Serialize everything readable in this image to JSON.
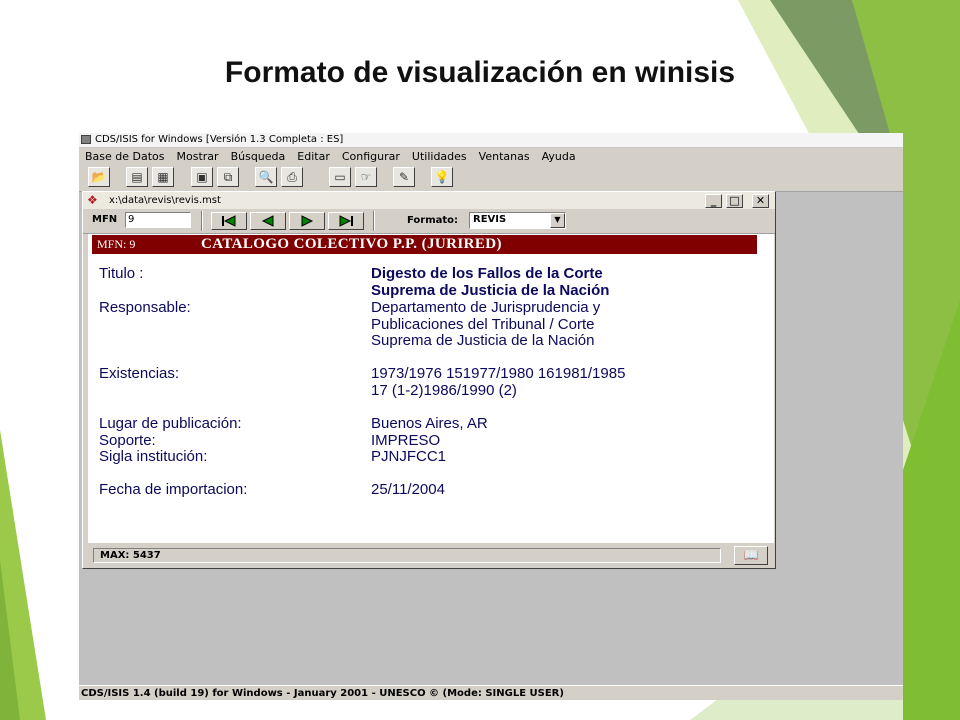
{
  "slide": {
    "title": "Formato de visualización en winisis"
  },
  "app": {
    "title": "CDS/ISIS for Windows [Versión 1.3 Completa : ES]",
    "menu": [
      "Base de Datos",
      "Mostrar",
      "Búsqueda",
      "Editar",
      "Configurar",
      "Utilidades",
      "Ventanas",
      "Ayuda"
    ],
    "status": "CDS/ISIS 1.4 (build 19) for Windows - January 2001 - UNESCO © (Mode: SINGLE USER)"
  },
  "child_window": {
    "title": "x:\\data\\revis\\revis.mst",
    "mfn_label": "MFN",
    "mfn_value": "9",
    "format_label": "Formato:",
    "format_value": "REVIS",
    "status_text": "MAX: 5437"
  },
  "record": {
    "header_mfn": "MFN: 9",
    "header_title": "CATALOGO COLECTIVO P.P. (JURIRED)",
    "fields": [
      {
        "label": "Titulo :",
        "lines": [
          "Digesto de los Fallos de la Corte",
          "Suprema de Justicia de la Nación"
        ],
        "bold": true
      },
      {
        "label": "Responsable:",
        "lines": [
          "Departamento de Jurisprudencia y",
          "Publicaciones del Tribunal / Corte",
          "Suprema de Justicia de la Nación"
        ]
      },
      {
        "label": "Existencias:",
        "lines": [
          "1973/1976 151977/1980 161981/1985",
          "17 (1-2)1986/1990 (2)"
        ]
      },
      {
        "label": "Lugar de publicación:",
        "lines": [
          "Buenos Aires, AR"
        ]
      },
      {
        "label": "Soporte:",
        "lines": [
          "IMPRESO"
        ]
      },
      {
        "label": "Sigla institución:",
        "lines": [
          "PJNJFCC1"
        ]
      },
      {
        "label": "Fecha de importacion:",
        "lines": [
          "25/11/2004"
        ]
      }
    ]
  },
  "colors": {
    "accent_green": "#8cc63f",
    "record_header_bg": "#800000",
    "record_text": "#0c0a5c",
    "window_gray": "#d4d0c8"
  }
}
